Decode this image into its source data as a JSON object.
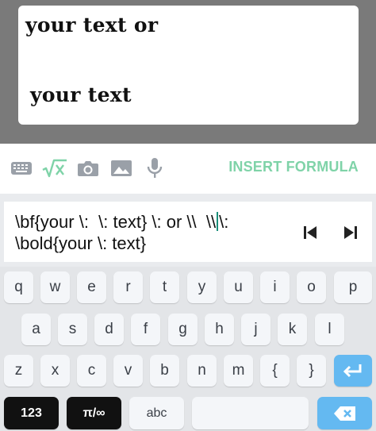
{
  "preview": {
    "line1": "your  text or",
    "line2": "your text"
  },
  "toolbar": {
    "icons": [
      "keyboard-icon",
      "sqrt-x-icon",
      "camera-icon",
      "image-icon",
      "microphone-icon"
    ],
    "insert_label": "INSERT FORMULA",
    "accent_color": "#7fd3a8"
  },
  "formula": {
    "line1_before_caret": "\\bf{your \\:  \\: text} \\: or \\\\  \\\\",
    "line1_after_caret": "\\:",
    "line2": "\\bold{your \\: text}"
  },
  "keyboard": {
    "row1": [
      "q",
      "w",
      "e",
      "r",
      "t",
      "y",
      "u",
      "i",
      "o",
      "p"
    ],
    "row2": [
      "a",
      "s",
      "d",
      "f",
      "g",
      "h",
      "j",
      "k",
      "l"
    ],
    "row3": [
      "z",
      "x",
      "c",
      "v",
      "b",
      "n",
      "m",
      "{",
      "}"
    ],
    "num_label": "123",
    "pi_label": "π/∞",
    "abc_label": "abc",
    "enter_color": "#64b9f1"
  }
}
